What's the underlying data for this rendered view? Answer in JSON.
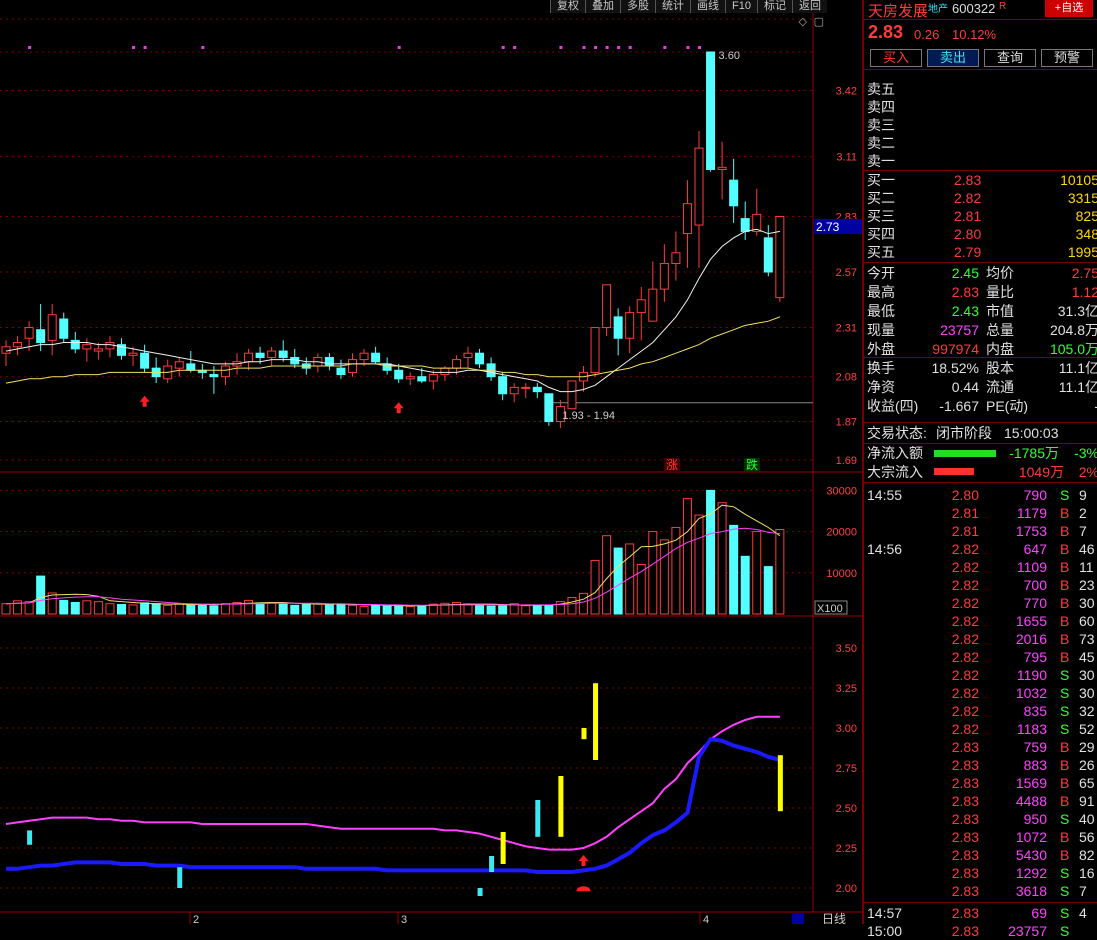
{
  "toolbar": [
    "复权",
    "叠加",
    "多股",
    "统计",
    "画线",
    "F10",
    "标记",
    "返回"
  ],
  "controls": "◇ ▢",
  "price_axis": [
    "3.60",
    "3.42",
    "3.11",
    "2.83",
    "2.57",
    "2.31",
    "2.08",
    "1.87",
    "1.69"
  ],
  "current_price_tag": "2.73",
  "annotations": {
    "high": "3.60",
    "low": "1.93 - 1.94",
    "zhang": "涨",
    "die": "跌"
  },
  "volume_axis": [
    "30000",
    "20000",
    "10000"
  ],
  "volume_unit": "X100",
  "indicator_axis": [
    "3.50",
    "3.25",
    "3.00",
    "2.75",
    "2.50",
    "2.25",
    "2.00"
  ],
  "date_axis": [
    "2",
    "3",
    "4"
  ],
  "bottom_tab": "日线",
  "chart_data": {
    "type": "candlestick",
    "y_range": [
      1.69,
      3.6
    ],
    "candles": [
      [
        2.19,
        2.25,
        2.13,
        2.22
      ],
      [
        2.22,
        2.27,
        2.18,
        2.24
      ],
      [
        2.26,
        2.34,
        2.2,
        2.31
      ],
      [
        2.3,
        2.42,
        2.2,
        2.24
      ],
      [
        2.25,
        2.42,
        2.18,
        2.37
      ],
      [
        2.35,
        2.38,
        2.24,
        2.26
      ],
      [
        2.25,
        2.29,
        2.19,
        2.21
      ],
      [
        2.21,
        2.26,
        2.15,
        2.23
      ],
      [
        2.2,
        2.24,
        2.16,
        2.21
      ],
      [
        2.21,
        2.27,
        2.17,
        2.24
      ],
      [
        2.23,
        2.26,
        2.16,
        2.18
      ],
      [
        2.18,
        2.22,
        2.13,
        2.19
      ],
      [
        2.19,
        2.23,
        2.1,
        2.12
      ],
      [
        2.12,
        2.17,
        2.05,
        2.08
      ],
      [
        2.07,
        2.16,
        2.05,
        2.13
      ],
      [
        2.12,
        2.17,
        2.08,
        2.15
      ],
      [
        2.14,
        2.2,
        2.1,
        2.11
      ],
      [
        2.11,
        2.14,
        2.07,
        2.1
      ],
      [
        2.09,
        2.13,
        2.0,
        2.08
      ],
      [
        2.08,
        2.15,
        2.04,
        2.13
      ],
      [
        2.13,
        2.19,
        2.09,
        2.15
      ],
      [
        2.15,
        2.21,
        2.11,
        2.19
      ],
      [
        2.19,
        2.22,
        2.14,
        2.17
      ],
      [
        2.17,
        2.22,
        2.13,
        2.2
      ],
      [
        2.2,
        2.25,
        2.15,
        2.17
      ],
      [
        2.17,
        2.21,
        2.12,
        2.14
      ],
      [
        2.14,
        2.17,
        2.09,
        2.12
      ],
      [
        2.13,
        2.19,
        2.1,
        2.17
      ],
      [
        2.17,
        2.19,
        2.11,
        2.13
      ],
      [
        2.12,
        2.16,
        2.07,
        2.09
      ],
      [
        2.1,
        2.19,
        2.08,
        2.16
      ],
      [
        2.16,
        2.21,
        2.13,
        2.19
      ],
      [
        2.19,
        2.22,
        2.14,
        2.15
      ],
      [
        2.14,
        2.17,
        2.09,
        2.11
      ],
      [
        2.11,
        2.14,
        2.05,
        2.07
      ],
      [
        2.07,
        2.1,
        2.04,
        2.08
      ],
      [
        2.08,
        2.12,
        2.05,
        2.06
      ],
      [
        2.06,
        2.11,
        2.02,
        2.09
      ],
      [
        2.09,
        2.13,
        2.06,
        2.12
      ],
      [
        2.12,
        2.18,
        2.09,
        2.16
      ],
      [
        2.17,
        2.22,
        2.12,
        2.19
      ],
      [
        2.19,
        2.21,
        2.12,
        2.14
      ],
      [
        2.14,
        2.17,
        2.06,
        2.08
      ],
      [
        2.08,
        2.1,
        1.97,
        2.0
      ],
      [
        2.0,
        2.05,
        1.96,
        2.03
      ],
      [
        2.03,
        2.05,
        1.98,
        2.03
      ],
      [
        2.03,
        2.05,
        1.98,
        2.01
      ],
      [
        2.0,
        1.99,
        1.85,
        1.87
      ],
      [
        1.87,
        1.97,
        1.84,
        1.94
      ],
      [
        1.93,
        2.06,
        1.93,
        2.06
      ],
      [
        2.06,
        2.13,
        2.01,
        2.1
      ],
      [
        2.1,
        2.31,
        2.08,
        2.31
      ],
      [
        2.31,
        2.51,
        2.27,
        2.51
      ],
      [
        2.36,
        2.4,
        2.18,
        2.26
      ],
      [
        2.26,
        2.41,
        2.19,
        2.38
      ],
      [
        2.38,
        2.5,
        2.25,
        2.44
      ],
      [
        2.34,
        2.62,
        2.34,
        2.49
      ],
      [
        2.49,
        2.7,
        2.43,
        2.61
      ],
      [
        2.61,
        2.76,
        2.53,
        2.66
      ],
      [
        2.75,
        3.0,
        2.59,
        2.89
      ],
      [
        2.79,
        3.23,
        2.59,
        3.15
      ],
      [
        3.6,
        3.6,
        3.04,
        3.05
      ],
      [
        3.05,
        3.18,
        2.91,
        3.06
      ],
      [
        3.0,
        3.1,
        2.8,
        2.88
      ],
      [
        2.82,
        2.9,
        2.72,
        2.76
      ],
      [
        2.76,
        2.96,
        2.74,
        2.84
      ],
      [
        2.73,
        2.79,
        2.55,
        2.57
      ],
      [
        2.45,
        2.83,
        2.43,
        2.83
      ]
    ],
    "ma_white": [
      2.2,
      2.21,
      2.22,
      2.23,
      2.23,
      2.24,
      2.24,
      2.24,
      2.23,
      2.23,
      2.22,
      2.21,
      2.2,
      2.19,
      2.18,
      2.17,
      2.16,
      2.15,
      2.14,
      2.14,
      2.14,
      2.15,
      2.15,
      2.16,
      2.16,
      2.16,
      2.15,
      2.15,
      2.14,
      2.14,
      2.14,
      2.14,
      2.14,
      2.14,
      2.13,
      2.12,
      2.11,
      2.1,
      2.1,
      2.1,
      2.11,
      2.11,
      2.1,
      2.09,
      2.08,
      2.07,
      2.06,
      2.03,
      2.01,
      2.01,
      2.02,
      2.04,
      2.08,
      2.12,
      2.16,
      2.2,
      2.24,
      2.3,
      2.36,
      2.44,
      2.54,
      2.63,
      2.69,
      2.73,
      2.76,
      2.77,
      2.75,
      2.76
    ],
    "ma_yellow": [
      2.05,
      2.06,
      2.07,
      2.07,
      2.08,
      2.08,
      2.09,
      2.09,
      2.09,
      2.1,
      2.1,
      2.1,
      2.1,
      2.1,
      2.1,
      2.11,
      2.11,
      2.11,
      2.11,
      2.11,
      2.12,
      2.12,
      2.12,
      2.13,
      2.13,
      2.13,
      2.13,
      2.13,
      2.13,
      2.13,
      2.14,
      2.14,
      2.14,
      2.13,
      2.13,
      2.13,
      2.13,
      2.12,
      2.12,
      2.12,
      2.12,
      2.11,
      2.11,
      2.1,
      2.1,
      2.09,
      2.09,
      2.08,
      2.08,
      2.08,
      2.08,
      2.09,
      2.1,
      2.11,
      2.12,
      2.14,
      2.15,
      2.17,
      2.19,
      2.21,
      2.23,
      2.26,
      2.28,
      2.3,
      2.32,
      2.33,
      2.34,
      2.36
    ],
    "volumes": [
      2500,
      3200,
      3000,
      9200,
      5100,
      3300,
      2800,
      3200,
      3000,
      2500,
      2300,
      2200,
      2700,
      2500,
      2100,
      2400,
      2200,
      2300,
      2000,
      2500,
      2800,
      3300,
      2700,
      2800,
      2400,
      2100,
      2500,
      2500,
      2400,
      2300,
      2100,
      1800,
      2200,
      1900,
      2000,
      1800,
      2000,
      2400,
      2600,
      2800,
      2400,
      2200,
      1900,
      2000,
      2500,
      2000,
      2000,
      2100,
      3000,
      4000,
      5000,
      13000,
      19000,
      16000,
      17000,
      12000,
      20000,
      18000,
      21000,
      28000,
      24000,
      30000,
      27000,
      21500,
      14000,
      20000,
      11500,
      20500
    ],
    "vol_ma5": [
      2500,
      2600,
      2700,
      4000,
      4600,
      4700,
      4800,
      4700,
      4300,
      3200,
      3000,
      2800,
      2600,
      2500,
      2400,
      2400,
      2300,
      2300,
      2300,
      2400,
      2500,
      2600,
      2700,
      2800,
      2800,
      2600,
      2500,
      2400,
      2400,
      2400,
      2300,
      2200,
      2200,
      2100,
      2000,
      2000,
      2000,
      2100,
      2200,
      2300,
      2400,
      2400,
      2400,
      2300,
      2200,
      2100,
      2100,
      2100,
      2400,
      2900,
      3600,
      5200,
      8600,
      11600,
      13900,
      16300,
      16400,
      17000,
      17900,
      20000,
      23200,
      24300,
      26400,
      26000,
      24200,
      22600,
      21000,
      19000
    ],
    "vol_ma10": [
      2500,
      2600,
      2700,
      3300,
      3700,
      3900,
      4100,
      4200,
      4200,
      3900,
      3600,
      3400,
      3200,
      3000,
      2800,
      2600,
      2500,
      2400,
      2400,
      2400,
      2400,
      2500,
      2500,
      2600,
      2600,
      2600,
      2600,
      2600,
      2500,
      2500,
      2400,
      2300,
      2300,
      2200,
      2200,
      2100,
      2100,
      2100,
      2100,
      2200,
      2200,
      2200,
      2200,
      2200,
      2200,
      2200,
      2200,
      2200,
      2300,
      2500,
      2900,
      3800,
      5300,
      7000,
      8700,
      10300,
      12100,
      14000,
      15900,
      17400,
      18400,
      19500,
      20000,
      20600,
      20800,
      20500,
      19800,
      19500
    ],
    "ind_range": [
      1.85,
      3.7
    ],
    "ind_magenta": [
      2.4,
      2.41,
      2.42,
      2.43,
      2.44,
      2.44,
      2.44,
      2.44,
      2.43,
      2.43,
      2.42,
      2.42,
      2.41,
      2.41,
      2.41,
      2.41,
      2.41,
      2.4,
      2.4,
      2.4,
      2.4,
      2.4,
      2.4,
      2.4,
      2.4,
      2.4,
      2.4,
      2.39,
      2.38,
      2.37,
      2.37,
      2.37,
      2.37,
      2.37,
      2.37,
      2.37,
      2.37,
      2.37,
      2.36,
      2.36,
      2.35,
      2.34,
      2.32,
      2.3,
      2.28,
      2.26,
      2.25,
      2.24,
      2.24,
      2.24,
      2.25,
      2.28,
      2.32,
      2.38,
      2.43,
      2.48,
      2.53,
      2.62,
      2.68,
      2.78,
      2.85,
      2.93,
      2.98,
      3.02,
      3.05,
      3.07,
      3.07,
      3.07
    ],
    "ind_blue": [
      2.12,
      2.12,
      2.13,
      2.14,
      2.14,
      2.15,
      2.16,
      2.16,
      2.16,
      2.16,
      2.15,
      2.15,
      2.15,
      2.14,
      2.14,
      2.14,
      2.13,
      2.13,
      2.13,
      2.13,
      2.13,
      2.13,
      2.13,
      2.13,
      2.13,
      2.13,
      2.12,
      2.12,
      2.12,
      2.12,
      2.12,
      2.12,
      2.12,
      2.11,
      2.11,
      2.11,
      2.11,
      2.11,
      2.11,
      2.11,
      2.11,
      2.11,
      2.11,
      2.11,
      2.11,
      2.11,
      2.1,
      2.1,
      2.1,
      2.1,
      2.11,
      2.12,
      2.14,
      2.18,
      2.22,
      2.28,
      2.33,
      2.36,
      2.41,
      2.47,
      2.82,
      2.93,
      2.92,
      2.89,
      2.87,
      2.85,
      2.82,
      2.8
    ],
    "ind_bars": [
      [
        2,
        2.27,
        2.36,
        "cyan"
      ],
      [
        15,
        2.0,
        2.13,
        "cyan"
      ],
      [
        41,
        1.95,
        2.0,
        "cyan"
      ],
      [
        42,
        2.1,
        2.2,
        "cyan"
      ],
      [
        43,
        2.15,
        2.35,
        "yellow"
      ],
      [
        46,
        2.32,
        2.55,
        "cyan"
      ],
      [
        48,
        2.32,
        2.7,
        "yellow"
      ],
      [
        50,
        2.93,
        3.0,
        "yellow"
      ],
      [
        51,
        2.8,
        3.28,
        "yellow"
      ],
      [
        67,
        2.48,
        2.83,
        "yellow"
      ]
    ],
    "dots_idx": [
      2,
      11,
      12,
      17,
      34,
      43,
      44,
      48,
      50,
      51,
      52,
      53,
      54,
      57,
      59,
      60
    ]
  },
  "stock": {
    "name": "天房发展",
    "tag": "地产",
    "code": "600322",
    "r": "R",
    "fav": "+自选",
    "price": "2.83",
    "change": "0.26",
    "pct": "10.12%"
  },
  "actions": [
    "买入",
    "卖出",
    "查询",
    "预警"
  ],
  "asks": [
    "卖五",
    "卖四",
    "卖三",
    "卖二",
    "卖一"
  ],
  "bids": [
    [
      "买一",
      "2.83",
      "10105"
    ],
    [
      "买二",
      "2.82",
      "3315"
    ],
    [
      "买三",
      "2.81",
      "825"
    ],
    [
      "买四",
      "2.80",
      "348"
    ],
    [
      "买五",
      "2.79",
      "1995"
    ]
  ],
  "stats": [
    [
      "今开",
      "2.45",
      "均价",
      "2.75"
    ],
    [
      "最高",
      "2.83",
      "量比",
      "1.12"
    ],
    [
      "最低",
      "2.43",
      "市值",
      "31.3亿"
    ],
    [
      "现量",
      "23757",
      "总量",
      "204.8万"
    ],
    [
      "外盘",
      "997974",
      "内盘",
      "105.0万"
    ],
    [
      "换手",
      "18.52%",
      "股本",
      "11.1亿"
    ],
    [
      "净资",
      "0.44",
      "流通",
      "11.1亿"
    ],
    [
      "收益(四)",
      "-1.667",
      "PE(动)",
      "-"
    ]
  ],
  "status": {
    "label": "交易状态:",
    "value": "闭市阶段",
    "time": "15:00:03"
  },
  "flow": [
    [
      "净流入额",
      "-1785万",
      "-3%"
    ],
    [
      "大宗流入",
      "1049万",
      "2%"
    ]
  ],
  "ticks": [
    [
      "14:55",
      "2.80",
      "790",
      "S",
      "9"
    ],
    [
      "",
      "2.81",
      "1179",
      "B",
      "2"
    ],
    [
      "",
      "2.81",
      "1753",
      "B",
      "7"
    ],
    [
      "14:56",
      "2.82",
      "647",
      "B",
      "46"
    ],
    [
      "",
      "2.82",
      "1109",
      "B",
      "11"
    ],
    [
      "",
      "2.82",
      "700",
      "B",
      "23"
    ],
    [
      "",
      "2.82",
      "770",
      "B",
      "30"
    ],
    [
      "",
      "2.82",
      "1655",
      "B",
      "60"
    ],
    [
      "",
      "2.82",
      "2016",
      "B",
      "73"
    ],
    [
      "",
      "2.82",
      "795",
      "B",
      "45"
    ],
    [
      "",
      "2.82",
      "1190",
      "S",
      "30"
    ],
    [
      "",
      "2.82",
      "1032",
      "S",
      "30"
    ],
    [
      "",
      "2.82",
      "835",
      "S",
      "32"
    ],
    [
      "",
      "2.82",
      "1183",
      "S",
      "52"
    ],
    [
      "",
      "2.83",
      "759",
      "B",
      "29"
    ],
    [
      "",
      "2.83",
      "883",
      "B",
      "26"
    ],
    [
      "",
      "2.83",
      "1569",
      "B",
      "65"
    ],
    [
      "",
      "2.83",
      "4488",
      "B",
      "91"
    ],
    [
      "",
      "2.83",
      "950",
      "S",
      "40"
    ],
    [
      "",
      "2.83",
      "1072",
      "B",
      "56"
    ],
    [
      "",
      "2.83",
      "5430",
      "B",
      "82"
    ],
    [
      "",
      "2.83",
      "1292",
      "S",
      "16"
    ],
    [
      "",
      "2.83",
      "3618",
      "S",
      "7"
    ],
    [
      "14:57",
      "2.83",
      "69",
      "S",
      "4"
    ],
    [
      "15:00",
      "2.83",
      "23757",
      "S",
      ""
    ]
  ]
}
